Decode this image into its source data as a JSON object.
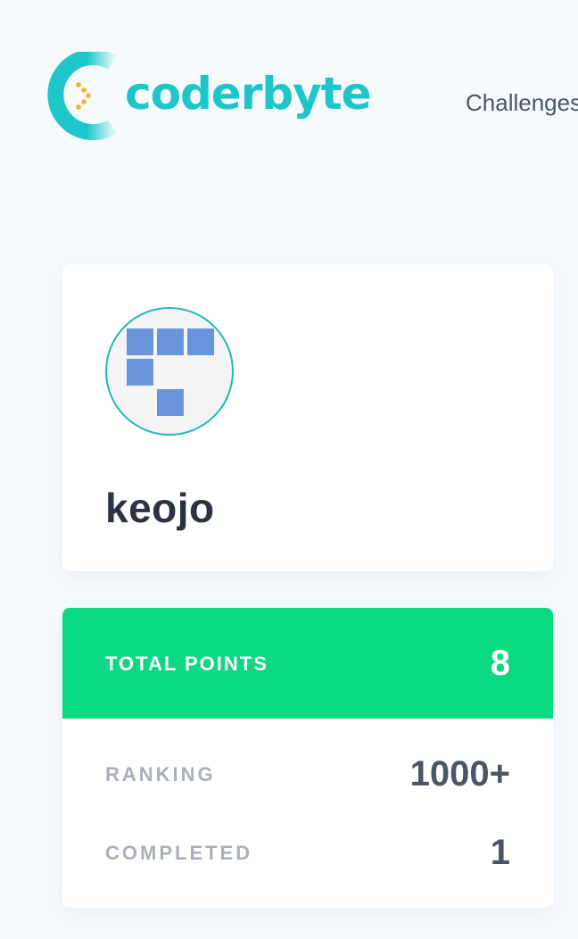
{
  "header": {
    "brand_name": "coderbyte",
    "nav": [
      {
        "label": "Challenges"
      }
    ]
  },
  "profile": {
    "username": "keojo"
  },
  "stats": {
    "total_points": {
      "label": "TOTAL POINTS",
      "value": "8"
    },
    "ranking": {
      "label": "RANKING",
      "value": "1000+"
    },
    "completed": {
      "label": "COMPLETED",
      "value": "1"
    }
  },
  "colors": {
    "brand": "#1ec6c9",
    "points_band": "#0bd981",
    "avatar_blocks": "#6a94d9",
    "page_background": "#f6fafd"
  }
}
